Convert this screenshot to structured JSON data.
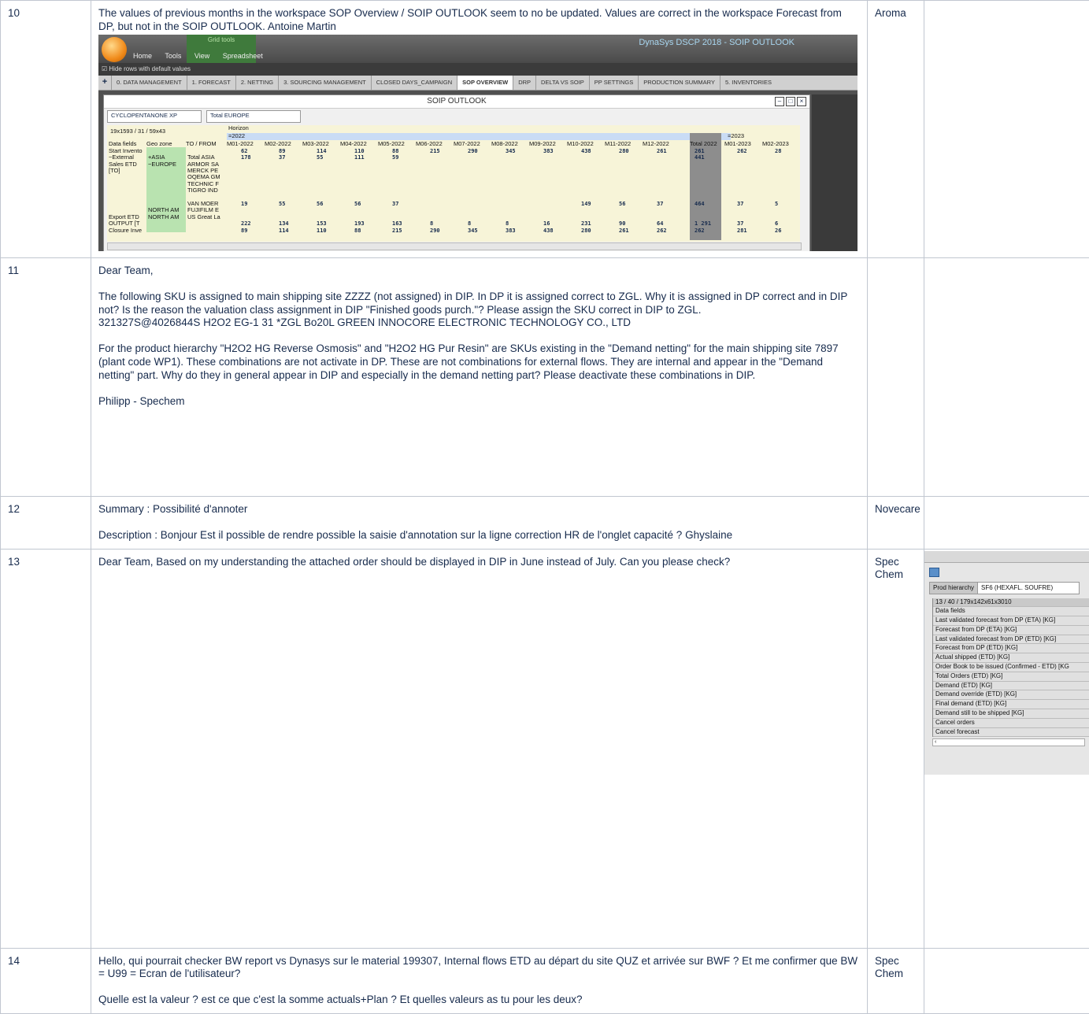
{
  "rows": [
    {
      "num": "10",
      "text": "The values of previous months in the workspace SOP Overview / SOIP OUTLOOK seem to no be updated. Values are correct in the workspace Forecast from DP, but not in the SOIP OUTLOOK. Antoine Martin",
      "bu": "Aroma"
    },
    {
      "num": "11",
      "paras": [
        "Dear Team,",
        "The following SKU is assigned to main shipping site ZZZZ (not assigned) in DIP. In DP it is assigned correct to ZGL. Why it is assigned in DP correct and in DIP not? Is the reason the valuation class assignment in DIP \"Finished goods purch.\"? Please assign the SKU correct in DIP to ZGL.",
        "321327S@4026844S H2O2 EG-1 31 *ZGL Bo20L GREEN INNOCORE ELECTRONIC TECHNOLOGY CO., LTD",
        "For the product hierarchy \"H2O2 HG Reverse Osmosis\" and \"H2O2 HG Pur Resin\" are SKUs existing in the \"Demand netting\" for the main shipping site 7897 (plant code WP1). These combinations are not activate in DP. These are not combinations for external flows. They are internal and appear in the \"Demand netting\" part. Why do they in general appear in DIP and especially in the demand netting part? Please deactivate these combinations in DIP.",
        "Philipp - Spechem"
      ],
      "bu": ""
    },
    {
      "num": "12",
      "summary": "Summary : Possibilité d'annoter",
      "description": "Description : Bonjour Est il possible de rendre possible la saisie d'annotation sur la ligne correction HR de l'onglet capacité ? Ghyslaine",
      "bu": "Novecare"
    },
    {
      "num": "13",
      "text": "Dear Team, Based on my understanding the attached order should be displayed in DIP in June instead of July. Can you please check?",
      "bu": "Spec Chem"
    },
    {
      "num": "14",
      "text1": "Hello, qui pourrait checker BW report vs Dynasys sur le material 199307, Internal flows ETD au départ du site QUZ et arrivée sur BWF ? Et me confirmer que BW = U99 = Ecran de l'utilisateur?",
      "text2": "Quelle est la valeur ? est ce que c'est la somme actuals+Plan ? Et quelles valeurs as tu pour les deux?",
      "bu": "Spec Chem"
    }
  ],
  "screenshot1": {
    "app_title": "DynaSys DSCP 2018 - SOIP OUTLOOK",
    "grid_tools": "Grid tools",
    "menu": [
      "Home",
      "Tools",
      "View",
      "Spreadsheet"
    ],
    "toolbar_label": "Hide rows with default values",
    "tabs": [
      "0. DATA MANAGEMENT",
      "1. FORECAST",
      "2. NETTING",
      "3. SOURCING MANAGEMENT",
      "CLOSED DAYS_CAMPAIGN",
      "SOP OVERVIEW",
      "DRP",
      "DELTA VS SOIP",
      "PP SETTINGS",
      "PRODUCTION SUMMARY",
      "5. INVENTORIES"
    ],
    "active_tab": "SOP OVERVIEW",
    "window_title": "SOIP OUTLOOK",
    "product": "CYCLOPENTANONE XP",
    "region": "Total EUROPE",
    "dims": "19x1593 / 31 / 59x43",
    "horizon": "Horizon",
    "year1": "=2022",
    "year2": "=2023",
    "col_headers": [
      "Data fields",
      "Geo zone",
      "TO / FROM",
      "M01-2022",
      "M02-2022",
      "M03-2022",
      "M04-2022",
      "M05-2022",
      "M06-2022",
      "M07-2022",
      "M08-2022",
      "M09-2022",
      "M10-2022",
      "M11-2022",
      "M12-2022",
      "Total 2022",
      "M01-2023",
      "M02-2023"
    ],
    "row_labels": [
      "Start Invento",
      "−External",
      "Sales ETD",
      "[TO]",
      "",
      "",
      "",
      "",
      "",
      "",
      "Export ETD",
      "OUTPUT [T",
      "Closure Inve"
    ],
    "geo_labels": [
      "+ASIA",
      "−EUROPE",
      "NORTH AM",
      "NORTH AM"
    ],
    "to_labels": [
      "Total ASIA",
      "ARMOR SA",
      "MERCK PE",
      "OQEMA GM",
      "TECHNIC F",
      "TIGRO IND",
      "VAN MOER",
      "FUJIFILM E",
      "US Great La"
    ],
    "start_inventory": [
      "62",
      "89",
      "114",
      "110",
      "88",
      "215",
      "290",
      "345",
      "383",
      "438",
      "280",
      "261",
      "261",
      "262",
      "28"
    ],
    "closure_inventory": [
      "89",
      "114",
      "110",
      "88",
      "215",
      "290",
      "345",
      "383",
      "438",
      "280",
      "261",
      "262",
      "262",
      "281",
      "26"
    ],
    "output": [
      "222",
      "134",
      "153",
      "193",
      "163",
      "8",
      "8",
      "8",
      "16",
      "231",
      "90",
      "64",
      "1 291",
      "37",
      "6"
    ],
    "total_asia": [
      "178",
      "37",
      "55",
      "111",
      "59",
      "",
      "",
      "",
      "",
      "",
      "",
      "",
      "441"
    ],
    "van_moer": [
      "19",
      "55",
      "56",
      "56",
      "37",
      "",
      "",
      "",
      "",
      "149",
      "56",
      "37",
      "464",
      "37",
      "5"
    ]
  },
  "screenshot2": {
    "tab_label": "Prod hierarchy",
    "product": "SF6 (HEXAFL. SOUFRE)",
    "fields": [
      "13 / 40 / 179x142x61x3010",
      "Data fields",
      "Last validated forecast from DP (ETA) [KG]",
      "Forecast from DP (ETA) [KG]",
      "Last validated forecast from DP (ETD) [KG]",
      "Forecast from DP (ETD) [KG]",
      "Actual shipped (ETD) [KG]",
      "Order Book to be issued (Confirmed - ETD) [KG",
      "Total Orders (ETD) [KG]",
      "Demand (ETD) [KG]",
      "Demand override (ETD) [KG]",
      "Final demand (ETD) [KG]",
      "Demand still to be shipped [KG]",
      "Cancel orders",
      "Cancel forecast"
    ]
  }
}
